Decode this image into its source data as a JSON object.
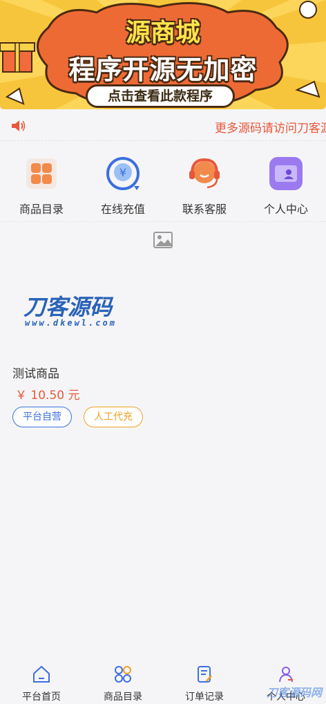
{
  "banner": {
    "title_line1": "源商城",
    "title_line2": "程序开源无加密",
    "button_label": "点击查看此款程序"
  },
  "notice": {
    "text": "更多源码请访问刀客源码网"
  },
  "nav": {
    "items": [
      {
        "label": "商品目录",
        "icon": "catalog-grid-icon"
      },
      {
        "label": "在线充值",
        "icon": "recharge-yen-icon"
      },
      {
        "label": "联系客服",
        "icon": "headset-service-icon"
      },
      {
        "label": "个人中心",
        "icon": "user-folder-icon"
      }
    ]
  },
  "product": {
    "image_logo_text": "刀客源码",
    "image_logo_url": "www.dkewl.com",
    "name": "测试商品",
    "price": "￥ 10.50 元",
    "tags": [
      "平台自营",
      "人工代充"
    ]
  },
  "tabbar": {
    "items": [
      {
        "label": "平台首页",
        "icon": "home-icon",
        "active": true
      },
      {
        "label": "商品目录",
        "icon": "grid-icon",
        "active": false
      },
      {
        "label": "订单记录",
        "icon": "order-icon",
        "active": false
      },
      {
        "label": "个人中心",
        "icon": "user-icon",
        "active": false
      }
    ]
  },
  "watermark": "刀客源码网",
  "colors": {
    "accent": "#e8573a",
    "blue": "#3b6fe0",
    "orange": "#f0a020",
    "banner_bg": "#f7c53b"
  }
}
